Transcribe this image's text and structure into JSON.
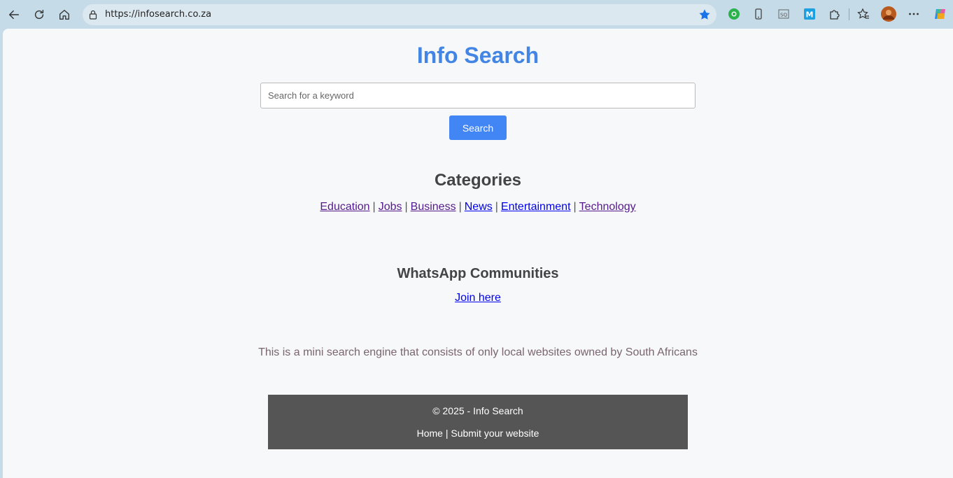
{
  "browser": {
    "url": "https://infosearch.co.za"
  },
  "site": {
    "title": "Info Search"
  },
  "search": {
    "placeholder": "Search for a keyword",
    "button_label": "Search"
  },
  "categories": {
    "heading": "Categories",
    "items": [
      {
        "label": "Education",
        "visited": true
      },
      {
        "label": "Jobs",
        "visited": true
      },
      {
        "label": "Business",
        "visited": true
      },
      {
        "label": "News",
        "visited": false
      },
      {
        "label": "Entertainment",
        "visited": false
      },
      {
        "label": "Technology",
        "visited": true
      }
    ],
    "separator": "|"
  },
  "whatsapp": {
    "heading": "WhatsApp Communities",
    "link_label": "Join here"
  },
  "description": "This is a mini search engine that consists of only local websites owned by South Africans",
  "footer": {
    "copyright": "© 2025 - Info Search",
    "home_label": "Home",
    "separator": "|",
    "submit_label": "Submit your website"
  },
  "colors": {
    "accent": "#4285f4",
    "title": "#4285e4",
    "footer_bg": "#555555",
    "visited_link": "#551a8b",
    "link": "#0000ee"
  }
}
